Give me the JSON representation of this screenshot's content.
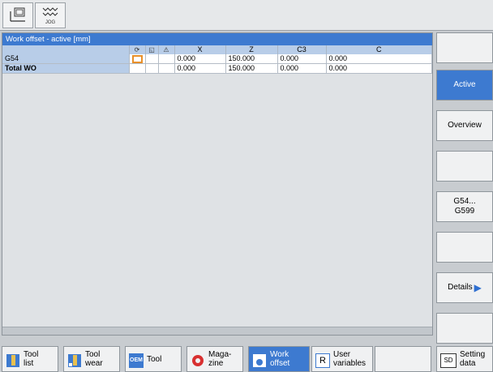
{
  "topbar": {
    "icons": [
      "machine-icon",
      "jog-icon"
    ],
    "jog_label": "JOG"
  },
  "panel": {
    "title": "Work offset - active [mm]",
    "columns": [
      "X",
      "Z",
      "C3",
      "C"
    ],
    "rows": [
      {
        "label": "G54",
        "values": [
          "0.000",
          "150.000",
          "0.000",
          "0.000"
        ]
      },
      {
        "label": "Total WO",
        "values": [
          "0.000",
          "150.000",
          "0.000",
          "0.000"
        ]
      }
    ]
  },
  "softkeys_right": [
    {
      "label": ""
    },
    {
      "label": "Active"
    },
    {
      "label": "Overview"
    },
    {
      "label": ""
    },
    {
      "label": "G54...\nG599"
    },
    {
      "label": ""
    },
    {
      "label": "Details"
    },
    {
      "label": ""
    }
  ],
  "softkeys_bottom": [
    {
      "line1": "Tool",
      "line2": "list"
    },
    {
      "line1": "Tool",
      "line2": "wear"
    },
    {
      "line1": "Tool",
      "line2": "",
      "icon_text": "OEM"
    },
    {
      "line1": "Maga-",
      "line2": "zine"
    },
    {
      "line1": "Work",
      "line2": "offset"
    },
    {
      "line1": "User",
      "line2": "variables",
      "icon_text": "R"
    },
    {
      "line1": "Setting",
      "line2": "data",
      "icon_text": "SD"
    }
  ],
  "colors": {
    "accent": "#3d7ad0",
    "highlight": "#e8902a"
  }
}
